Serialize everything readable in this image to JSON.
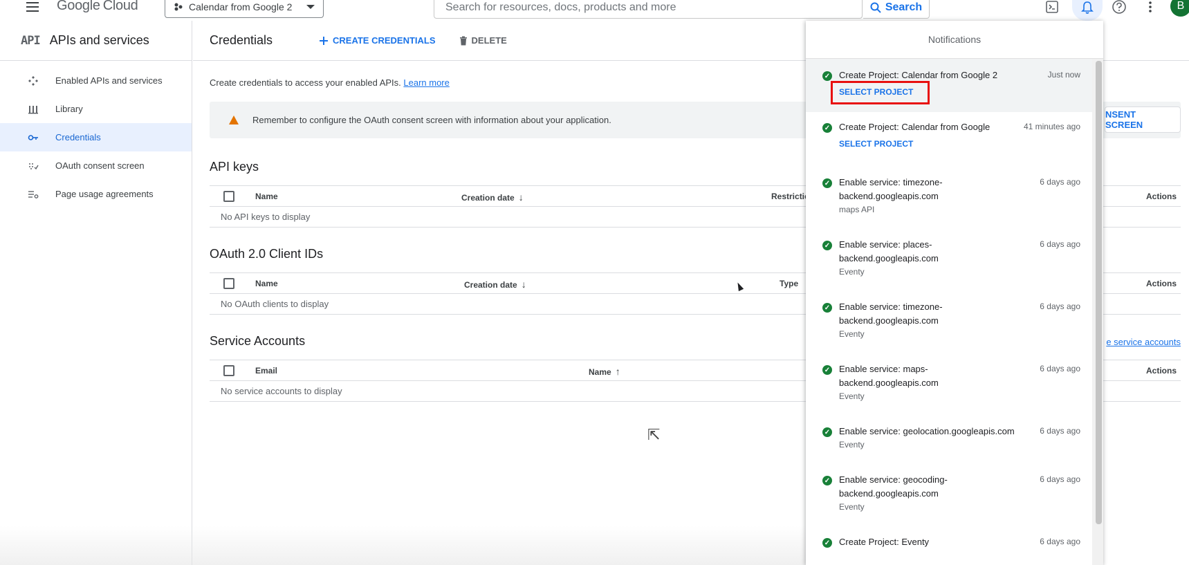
{
  "topbar": {
    "logo_google": "Google",
    "logo_cloud": "Cloud",
    "project": "Calendar from Google 2",
    "search_placeholder": "Search for resources, docs, products and more",
    "search_button": "Search",
    "avatar_letter": "B"
  },
  "leftnav": {
    "logo": "API",
    "title": "APIs and services",
    "items": [
      {
        "label": "Enabled APIs and services",
        "icon": "enabled-apis-icon",
        "active": false
      },
      {
        "label": "Library",
        "icon": "library-icon",
        "active": false
      },
      {
        "label": "Credentials",
        "icon": "key-icon",
        "active": true
      },
      {
        "label": "OAuth consent screen",
        "icon": "consent-icon",
        "active": false
      },
      {
        "label": "Page usage agreements",
        "icon": "settings-list-icon",
        "active": false
      }
    ]
  },
  "main": {
    "title": "Credentials",
    "create_label": "CREATE CREDENTIALS",
    "delete_label": "DELETE",
    "intro_text": "Create credentials to access your enabled APIs.",
    "learn_more": "Learn more",
    "banner_text": "Remember to configure the OAuth consent screen with information about your application.",
    "consent_button": "NSENT SCREEN",
    "api_keys": {
      "title": "API keys",
      "columns": [
        "Name",
        "Creation date",
        "Restrictions",
        "Actions"
      ],
      "empty": "No API keys to display"
    },
    "oauth": {
      "title": "OAuth 2.0 Client IDs",
      "columns": [
        "Name",
        "Creation date",
        "Type",
        "Actions"
      ],
      "empty": "No OAuth clients to display"
    },
    "service_accounts": {
      "title": "Service Accounts",
      "columns": [
        "Email",
        "Name",
        "Actions"
      ],
      "empty": "No service accounts to display",
      "manage_link": "e service accounts"
    }
  },
  "notifications": {
    "title": "Notifications",
    "items": [
      {
        "title": "Create Project: Calendar from Google 2",
        "time": "Just now",
        "link": "SELECT PROJECT",
        "sub": ""
      },
      {
        "title": "Create Project: Calendar from Google",
        "time": "41 minutes ago",
        "link": "SELECT PROJECT",
        "sub": ""
      },
      {
        "title": "Enable service: timezone-backend.googleapis.com",
        "time": "6 days ago",
        "link": "",
        "sub": "maps API"
      },
      {
        "title": "Enable service: places-backend.googleapis.com",
        "time": "6 days ago",
        "link": "",
        "sub": "Eventy"
      },
      {
        "title": "Enable service: timezone-backend.googleapis.com",
        "time": "6 days ago",
        "link": "",
        "sub": "Eventy"
      },
      {
        "title": "Enable service: maps-backend.googleapis.com",
        "time": "6 days ago",
        "link": "",
        "sub": "Eventy"
      },
      {
        "title": "Enable service: geolocation.googleapis.com",
        "time": "6 days ago",
        "link": "",
        "sub": "Eventy"
      },
      {
        "title": "Enable service: geocoding-backend.googleapis.com",
        "time": "6 days ago",
        "link": "",
        "sub": "Eventy"
      },
      {
        "title": "Create Project: Eventy",
        "time": "6 days ago",
        "link": "",
        "sub": ""
      }
    ]
  },
  "colors": {
    "accent": "#1a73e8",
    "success": "#188038",
    "warning": "#e37400",
    "highlight_box": "#e8100f"
  }
}
